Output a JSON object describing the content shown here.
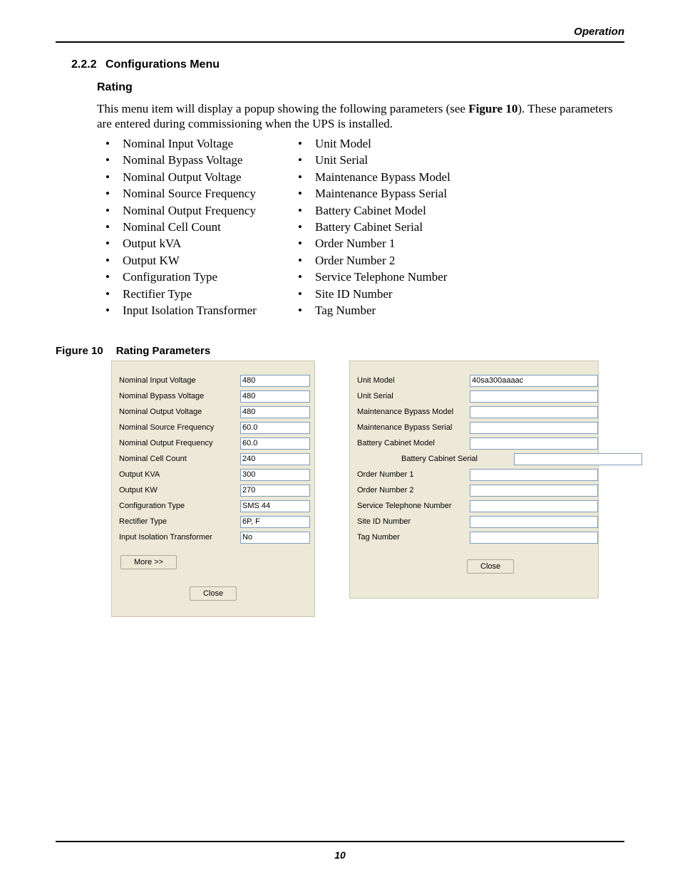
{
  "header": {
    "section": "Operation"
  },
  "page_number": "10",
  "section": {
    "number": "2.2.2",
    "title": "Configurations Menu",
    "subtitle": "Rating",
    "paragraph_pre": "This menu item will display a popup showing the following parameters (see ",
    "paragraph_ref": "Figure 10",
    "paragraph_post": "). These parameters are entered during commissioning when the UPS is installed."
  },
  "params_col1": [
    "Nominal Input Voltage",
    "Nominal Bypass Voltage",
    "Nominal Output Voltage",
    "Nominal Source Frequency",
    "Nominal Output Frequency",
    "Nominal Cell Count",
    "Output kVA",
    "Output KW",
    "Configuration Type",
    "Rectifier Type",
    "Input Isolation Transformer"
  ],
  "params_col2": [
    "Unit Model",
    "Unit Serial",
    "Maintenance Bypass Model",
    "Maintenance Bypass Serial",
    "Battery Cabinet Model",
    "Battery Cabinet Serial",
    "Order Number 1",
    "Order Number 2",
    "Service Telephone Number",
    "Site ID Number",
    "Tag Number"
  ],
  "figure_caption": {
    "num": "Figure 10",
    "title": "Rating Parameters"
  },
  "panel1": {
    "rows": [
      {
        "label": "Nominal Input Voltage",
        "value": "480"
      },
      {
        "label": "Nominal Bypass Voltage",
        "value": "480"
      },
      {
        "label": "Nominal Output Voltage",
        "value": "480"
      },
      {
        "label": "Nominal Source Frequency",
        "value": "60.0"
      },
      {
        "label": "Nominal Output Frequency",
        "value": "60.0"
      },
      {
        "label": "Nominal Cell Count",
        "value": "240"
      },
      {
        "label": "Output KVA",
        "value": "300"
      },
      {
        "label": "Output KW",
        "value": "270"
      },
      {
        "label": "Configuration Type",
        "value": "SMS 44"
      },
      {
        "label": "Rectifier Type",
        "value": "6P, F"
      },
      {
        "label": "Input Isolation Transformer",
        "value": "No"
      }
    ],
    "more": "More >>",
    "close": "Close"
  },
  "panel2": {
    "rows": [
      {
        "label": "Unit Model",
        "value": "40sa300aaaac"
      },
      {
        "label": "Unit Serial",
        "value": ""
      },
      {
        "label": "Maintenance Bypass Model",
        "value": ""
      },
      {
        "label": "Maintenance Bypass Serial",
        "value": ""
      },
      {
        "label": "Battery Cabinet Model",
        "value": ""
      },
      {
        "label": "Battery Cabinet Serial",
        "value": "",
        "indent": true
      },
      {
        "label": "Order Number 1",
        "value": ""
      },
      {
        "label": "Order Number 2",
        "value": ""
      },
      {
        "label": "Service Telephone Number",
        "value": ""
      },
      {
        "label": "Site ID Number",
        "value": ""
      },
      {
        "label": "Tag Number",
        "value": ""
      }
    ],
    "close": "Close"
  }
}
